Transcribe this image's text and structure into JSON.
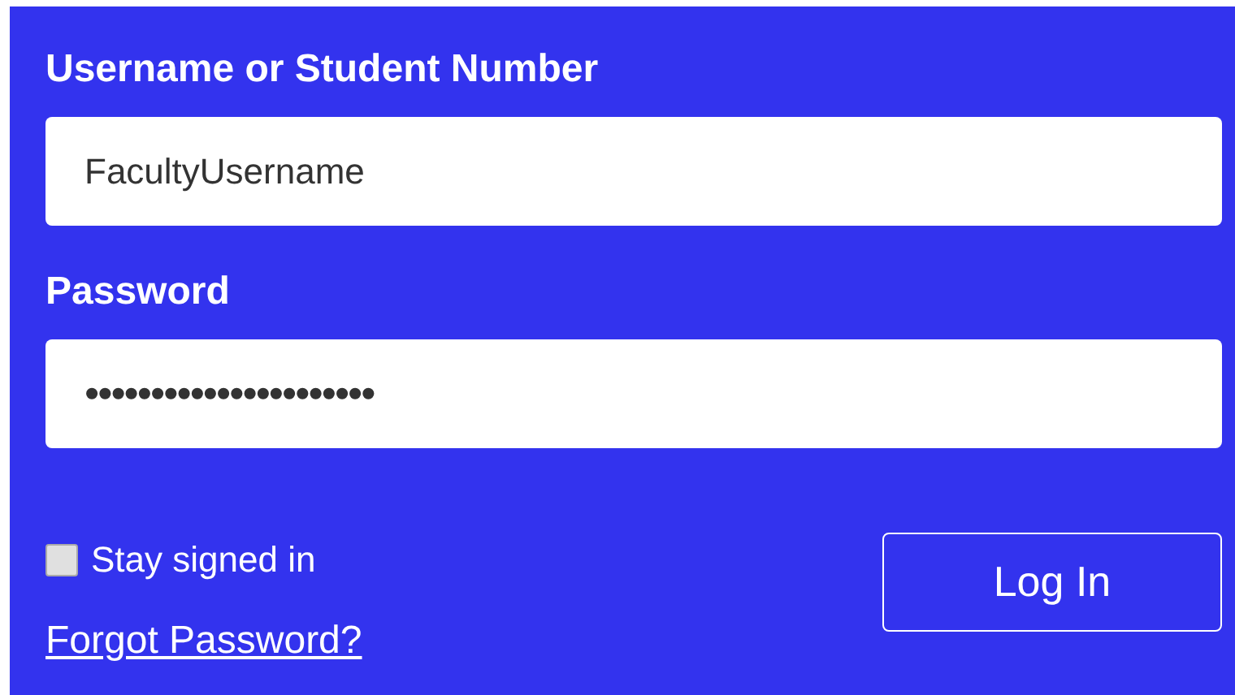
{
  "username": {
    "label": "Username or Student Number",
    "value": "FacultyUsername"
  },
  "password": {
    "label": "Password",
    "value": "••••••••••••••••••••••"
  },
  "stay_signed_in": {
    "label": "Stay signed in",
    "checked": false
  },
  "forgot_link": "Forgot Password?",
  "login_button": "Log In"
}
